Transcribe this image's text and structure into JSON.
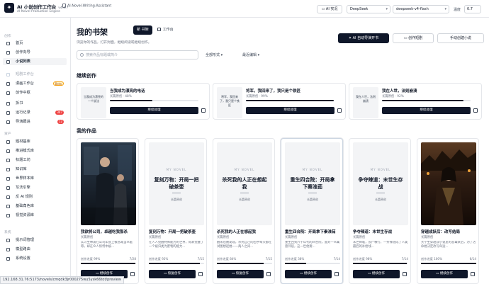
{
  "header": {
    "logo_glyph": "✦",
    "app_title": "AI 小说创作工作台",
    "version": "v4.4.7",
    "app_subtitle": "AI Novel Production Engine",
    "doc_tab": "AI-Novel-Writing-Assistant",
    "realtime_label": "AI 实况",
    "provider": "DeepSeek",
    "model": "deepseek-v4-flash",
    "temperature_label": "温度",
    "temperature_value": "0.7"
  },
  "sidebar": {
    "sections": [
      "创作",
      "资产",
      "系统"
    ],
    "items": [
      {
        "label": "首页"
      },
      {
        "label": "创作向导"
      },
      {
        "label": "小说列表",
        "active": true
      },
      {
        "label": "短剧工作台",
        "muted": true
      },
      {
        "label": "漫画工作台",
        "badge": "Beta"
      },
      {
        "label": "创作中枢"
      },
      {
        "label": "拆书"
      },
      {
        "label": "运行记录",
        "badge": "347"
      },
      {
        "label": "导演跟进",
        "badge": "12"
      },
      {
        "label": "题材基库"
      },
      {
        "label": "推进模式库"
      },
      {
        "label": "标题工坊"
      },
      {
        "label": "知识库"
      },
      {
        "label": "世界样本库"
      },
      {
        "label": "写法引擎"
      },
      {
        "label": "反 AI 规则"
      },
      {
        "label": "基础角色库"
      },
      {
        "label": "视觉资源库"
      },
      {
        "label": "提示词管理"
      },
      {
        "label": "模型路由"
      },
      {
        "label": "系统设置"
      }
    ]
  },
  "main": {
    "title": "我的书架",
    "view_shelf": "书架",
    "view_shelf_prefix": "新",
    "view_workbench": "工作台",
    "subtitle": "浏览你的作品，打开封面，继续阅读或继续创作。",
    "actions": {
      "ai_start": "AI 自动导演开书",
      "short_drama": "创作短剧",
      "manual": "手动创建小说"
    },
    "search_placeholder": "搜索作品标题或简介",
    "filter_all": "全部形式",
    "filter_sort": "最近编辑",
    "continue_heading": "继续创作",
    "works_heading": "我的作品"
  },
  "continue_cards": [
    {
      "thumb": "当我成为漂亮的一个说法",
      "title": "当我成为漂亮的电话",
      "meta": "长篇原创 · 48%",
      "progress": 48,
      "button": "继续处理"
    },
    {
      "thumb": "将军，我回来了，我只是个铁匠",
      "title": "将军，我回来了，我只是个铁匠",
      "meta": "长篇原创 · 99%",
      "progress": 99,
      "button": "继续处理"
    },
    {
      "thumb": "我在人世，法则崩溃",
      "title": "我在人世，法则崩溃",
      "meta": "长篇原创 · 92%",
      "progress": 92,
      "button": "继续处理"
    }
  ],
  "works": [
    {
      "cover_kind": "image",
      "title": "我欲将公司，卓越吃我那杀",
      "type": "长篇原创",
      "desc": "实习生林浦在公司年会上被总裁当众羞辱，却在众人惊愕中被...",
      "prog_label": "创作进度 99%",
      "prog_value": "7/28",
      "progress": 99,
      "button": "继续创作"
    },
    {
      "cover_kind": "plain",
      "cover_label": "MY NOVEL",
      "cover_title": "复刻万物：开局一把破茶壶",
      "cover_foot": "长篇原创",
      "title": "复刻万物：开局一把破茶壶",
      "type": "长篇原创",
      "desc": "在人人觉醒特殊能力的世界，陈默觉醒了一个被归类为废物的能力...",
      "prog_label": "创作进度 92%",
      "prog_value": "7/15",
      "progress": 92,
      "button": "恢复创作"
    },
    {
      "cover_kind": "plain",
      "cover_label": "MY NOVEL",
      "cover_title": "杀死我的人正在想起我",
      "cover_foot": "长篇原创",
      "title": "杀死我的人正在想起我",
      "type": "长篇原创",
      "desc": "醒来后她发现，杀死自己的凶手每天都在试图想起她——两人之间...",
      "prog_label": "创作进度 84%",
      "prog_value": "7/15",
      "progress": 84,
      "button": "恢复创作"
    },
    {
      "cover_kind": "plain",
      "cover_label": "MY NOVEL",
      "cover_title": "重生四合院：开局拿下秦淮茹",
      "cover_foot": "长篇原创",
      "title": "重生四合院：开局拿下秦淮茹",
      "type": "长篇原创",
      "desc": "重生回到六十年代的四合院，面对一众禽兽邻居，这一世他要...",
      "prog_label": "创作进度 38%",
      "prog_value": "7/14",
      "progress": 38,
      "button": "继续创作",
      "focus": true
    },
    {
      "cover_kind": "plain",
      "cover_label": "MY NOVEL",
      "cover_title": "争夺辣道：末世生存战",
      "cover_foot": "长篇原创",
      "title": "争夺辣道：末世生存战",
      "type": "长篇原创",
      "desc": "末世降临，丧尸横行，一条辣道成了人类最后的补给线...",
      "prog_label": "创作进度 98%",
      "prog_value": "7/14",
      "progress": 98,
      "button": "继续创作"
    },
    {
      "cover_kind": "image2",
      "title": "穿越成妖后：改写结局",
      "type": "长篇原创",
      "desc": "大学生穿越成小说里的恶毒妖后，为了活命她决定改写命运...",
      "prog_label": "创作进度 100%",
      "prog_value": "6/14",
      "progress": 100,
      "button": "继续创作"
    }
  ],
  "status_url": "192.168.31.76:5173/novels/cmqdk3jr000275wu5ysk66tot/preview"
}
